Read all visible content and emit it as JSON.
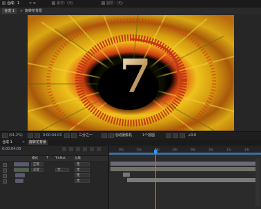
{
  "panels": {
    "tab1": "合成：1",
    "tab2": "素材：(无)",
    "tab3": "图层：(无)"
  },
  "viewer_tabs": {
    "tab1": "合成 1",
    "tab2": "旋转花背景"
  },
  "composition": {
    "number_text": "7",
    "colors": {
      "flower": "#e2b00f",
      "center": "#000000",
      "number": "#e9d6b0",
      "arc": "#c8361a"
    }
  },
  "viewer_toolbar": {
    "zoom": "(91.2%)",
    "timecode": "0:00:04:03",
    "quality": "三分之一",
    "camera": "活动摄像机",
    "views": "1个视图",
    "exposure": "+0.0"
  },
  "timeline": {
    "tab1": "合成 1",
    "tab2": "旋转花背景",
    "timecode": "0:00:04:03",
    "columns": {
      "mode": "模式",
      "trkmat": "TrkMat",
      "parent": "父级"
    },
    "rows": [
      {
        "mode": "正常",
        "trkmat": "",
        "parent": "无"
      },
      {
        "mode": "正常",
        "trkmat": "无",
        "parent": "无"
      },
      {
        "mode": "",
        "trkmat": "",
        "parent": "无"
      },
      {
        "mode": "",
        "trkmat": "",
        "parent": "无"
      }
    ],
    "ruler": [
      "00s",
      "02s",
      "04s",
      "06s",
      "08s",
      "10s",
      "12s",
      "14s"
    ],
    "playhead_position_s": 4.1
  }
}
